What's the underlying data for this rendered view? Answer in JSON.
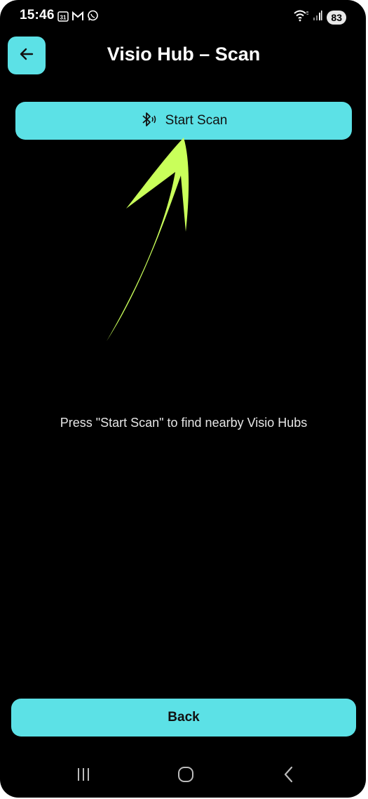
{
  "status_bar": {
    "time": "15:46",
    "calendar_day": "31",
    "battery": "83",
    "wifi_badge": "5"
  },
  "header": {
    "title": "Visio Hub – Scan"
  },
  "actions": {
    "start_scan_label": "Start Scan",
    "back_label": "Back"
  },
  "main": {
    "hint": "Press \"Start Scan\" to find nearby Visio Hubs"
  },
  "colors": {
    "accent": "#5ce1e6",
    "background": "#000000",
    "annotation_arrow": "#c9ff5a"
  },
  "icons": {
    "app_back": "arrow-left-icon",
    "scan": "bluetooth-searching-icon",
    "nav_recents": "recents-icon",
    "nav_home": "home-icon",
    "nav_back": "nav-back-icon"
  }
}
